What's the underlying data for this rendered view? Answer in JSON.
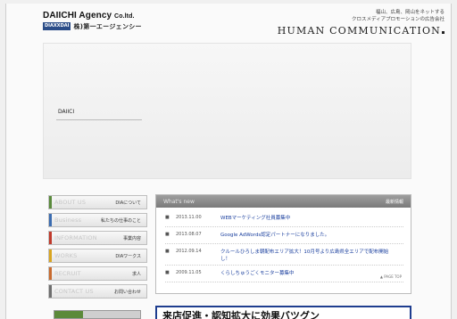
{
  "header": {
    "logo_en": "DAIICHI Agency",
    "logo_en_suffix": "Co.ltd.",
    "logo_badge": "DIAXXDAI",
    "logo_jp": "株)第一エージェンシー",
    "tagline_line1": "福山、広島、岡山をネットする",
    "tagline_line2": "クロスメディアプロモーションの広告会社",
    "brand": "HUMAN COMMUNICATION"
  },
  "hero": {
    "label": "DAIICI"
  },
  "nav": {
    "items": [
      {
        "en": "ABOUT US",
        "jp": "DIAについて",
        "color": "#5a8a3c"
      },
      {
        "en": "Business",
        "jp": "私たちの仕事のこと",
        "color": "#3b6cb0"
      },
      {
        "en": "INFORMATION",
        "jp": "事業内容",
        "color": "#c0392b"
      },
      {
        "en": "WORKS",
        "jp": "DIAワークス",
        "color": "#d9a520"
      },
      {
        "en": "RECRUIT",
        "jp": "求人",
        "color": "#c86a2e"
      },
      {
        "en": "CONTACT US",
        "jp": "お問い合わせ",
        "color": "#6e6e6e"
      }
    ]
  },
  "news": {
    "title": "What's new",
    "more_label": "最新情報",
    "pagetop": "▲ PAGE TOP",
    "items": [
      {
        "date": "2013.11.00",
        "text": "WEBマーケティング社員募集中"
      },
      {
        "date": "2013.08.07",
        "text": "Google AdWords認定パートナーになりました。"
      },
      {
        "date": "2012.09.14",
        "text": "クルールひろしま朝配布エリア拡大！10月号より広島県全エリアで配布開始し！"
      },
      {
        "date": "2009.11.05",
        "text": "くらしちゅうごくモニター募集中"
      }
    ]
  },
  "banner": {
    "left_text": "",
    "right_text": "来店促進・認知拡大に効果バツグン"
  },
  "colors": {
    "news_link": "#1a3f9e",
    "brand_blue": "#2b4d88"
  }
}
